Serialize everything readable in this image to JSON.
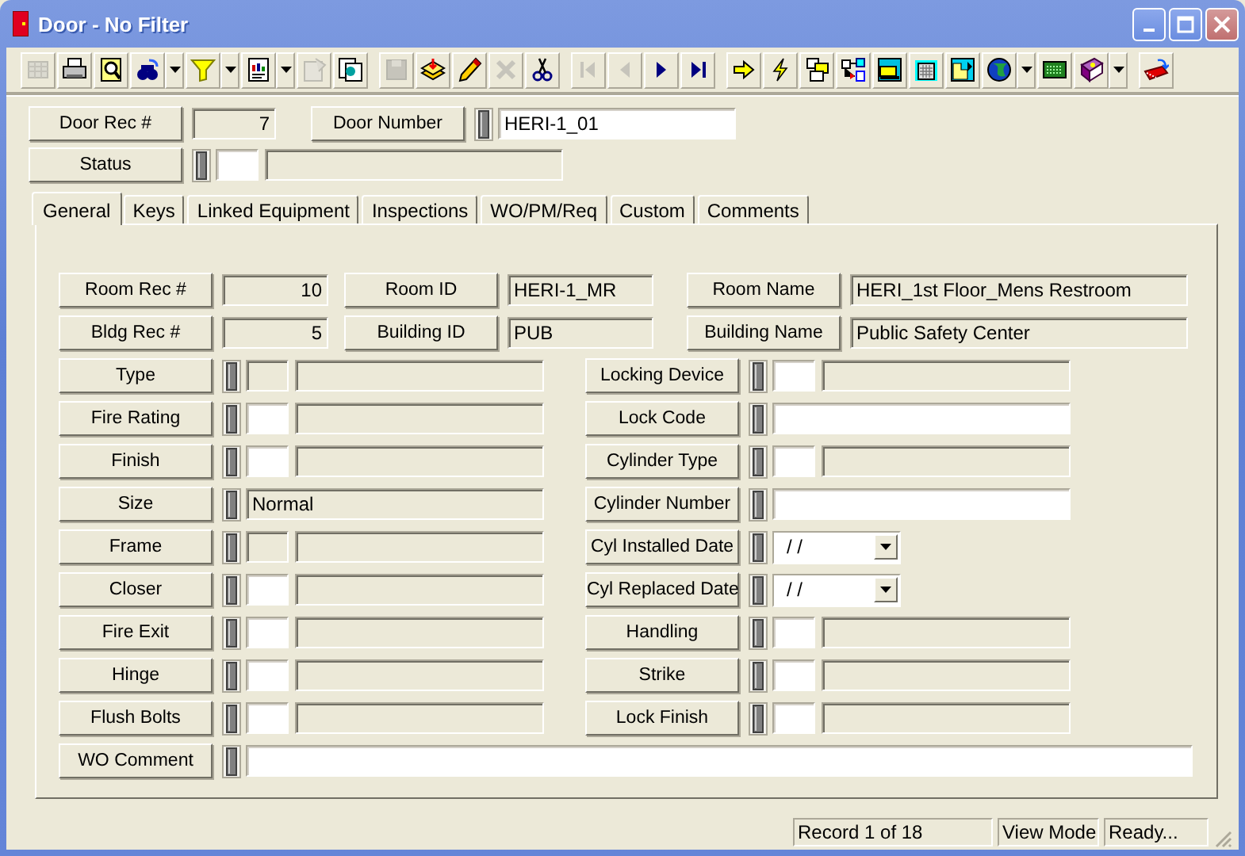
{
  "window": {
    "title": "Door - No Filter"
  },
  "toolbar": {
    "groups": [
      [
        {
          "kind": "button",
          "disabled": true
        },
        {
          "kind": "button",
          "disabled": false
        },
        {
          "kind": "button",
          "disabled": false
        },
        {
          "kind": "split",
          "disabled": false
        },
        {
          "kind": "split",
          "disabled": false
        },
        {
          "kind": "split",
          "disabled": false
        },
        {
          "kind": "button",
          "disabled": true
        },
        {
          "kind": "button",
          "disabled": false
        }
      ],
      [
        {
          "kind": "button",
          "disabled": true
        },
        {
          "kind": "button",
          "disabled": false
        },
        {
          "kind": "button",
          "disabled": false
        },
        {
          "kind": "button",
          "disabled": true
        },
        {
          "kind": "button",
          "disabled": false
        }
      ],
      [
        {
          "kind": "button",
          "disabled": true
        },
        {
          "kind": "button",
          "disabled": true
        },
        {
          "kind": "button",
          "disabled": false
        },
        {
          "kind": "button",
          "disabled": false
        }
      ],
      [
        {
          "kind": "button",
          "disabled": false
        },
        {
          "kind": "button",
          "disabled": false
        },
        {
          "kind": "button",
          "disabled": false
        },
        {
          "kind": "button",
          "disabled": false
        },
        {
          "kind": "button",
          "disabled": false
        },
        {
          "kind": "button",
          "disabled": false
        },
        {
          "kind": "button",
          "disabled": false
        },
        {
          "kind": "split",
          "disabled": false
        },
        {
          "kind": "button",
          "disabled": false
        },
        {
          "kind": "split",
          "disabled": false
        }
      ],
      [
        {
          "kind": "button",
          "disabled": false
        }
      ]
    ]
  },
  "header": {
    "rows": [
      [
        {
          "kind": "number",
          "label": "Door Rec #",
          "value": "7"
        },
        {
          "kind": "lookup",
          "label": "Door Number",
          "value": "HERI-1_01",
          "disabled": false
        }
      ],
      [
        {
          "kind": "code",
          "label": "Status",
          "disabled": false
        }
      ]
    ]
  },
  "tabs": [
    {
      "label": "General",
      "selected": true
    },
    {
      "label": "Keys",
      "selected": false
    },
    {
      "label": "Linked Equipment",
      "selected": false
    },
    {
      "label": "Inspections",
      "selected": false
    },
    {
      "label": "WO/PM/Req",
      "selected": false
    },
    {
      "label": "Custom",
      "selected": false
    },
    {
      "label": "Comments",
      "selected": false
    }
  ],
  "panel": {
    "top_rows": [
      [
        {
          "kind": "number",
          "label": "Room Rec #",
          "value": "10"
        },
        {
          "kind": "text",
          "label": "Room ID",
          "value": "HERI-1_MR",
          "disabled": true
        },
        {
          "kind": "text",
          "label": "Room Name",
          "value": "HERI_1st Floor_Mens Restroom",
          "disabled": true
        }
      ],
      [
        {
          "kind": "number",
          "label": "Bldg Rec #",
          "value": "5"
        },
        {
          "kind": "text",
          "label": "Building ID",
          "value": "PUB",
          "disabled": true
        },
        {
          "kind": "text",
          "label": "Building Name",
          "value": "Public Safety Center",
          "disabled": true
        }
      ]
    ],
    "left_fields": [
      {
        "kind": "code",
        "label": "Type",
        "disabled": true
      },
      {
        "kind": "code",
        "label": "Fire Rating",
        "disabled": false
      },
      {
        "kind": "code",
        "label": "Finish",
        "disabled": false
      },
      {
        "kind": "lookup",
        "label": "Size",
        "value": "Normal",
        "disabled": true
      },
      {
        "kind": "code",
        "label": "Frame",
        "disabled": true
      },
      {
        "kind": "code",
        "label": "Closer",
        "disabled": false
      },
      {
        "kind": "code",
        "label": "Fire Exit",
        "disabled": false
      },
      {
        "kind": "code",
        "label": "Hinge",
        "disabled": false
      },
      {
        "kind": "code",
        "label": "Flush Bolts",
        "disabled": false
      }
    ],
    "right_fields": [
      {
        "kind": "code",
        "label": "Locking Device",
        "disabled": false
      },
      {
        "kind": "lookup",
        "label": "Lock Code",
        "disabled": false
      },
      {
        "kind": "code",
        "label": "Cylinder Type",
        "disabled": false
      },
      {
        "kind": "lookup",
        "label": "Cylinder Number",
        "disabled": false
      },
      {
        "kind": "date",
        "label": "Cyl Installed Date",
        "value": "/ /"
      },
      {
        "kind": "date",
        "label": "Cyl Replaced Date",
        "value": "/ /"
      },
      {
        "kind": "code",
        "label": "Handling",
        "disabled": false
      },
      {
        "kind": "code",
        "label": "Strike",
        "disabled": false
      },
      {
        "kind": "code",
        "label": "Lock Finish",
        "disabled": false
      }
    ],
    "comment_field": {
      "kind": "lookup",
      "label": "WO Comment",
      "disabled": false
    }
  },
  "status_bar": [
    "Record 1 of 18",
    "View Mode",
    "Ready..."
  ]
}
